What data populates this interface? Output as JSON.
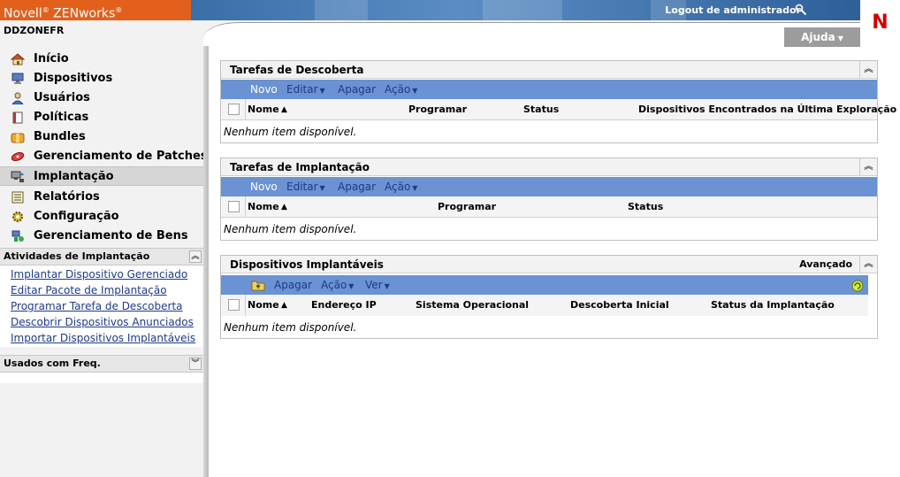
{
  "header": {
    "brand": "Novell® ZENworks®",
    "brand_name": "Novell",
    "brand_product": "ZENworks",
    "logout_label": "Logout de administrador",
    "logo_letter": "N",
    "zone_name": "DDZONEFR",
    "help_label": "Ajuda",
    "brand_color": "#e2601c"
  },
  "sidebar": {
    "nav": [
      {
        "label": "Início",
        "icon": "home-icon"
      },
      {
        "label": "Dispositivos",
        "icon": "monitor-icon"
      },
      {
        "label": "Usuários",
        "icon": "user-icon"
      },
      {
        "label": "Políticas",
        "icon": "policy-icon"
      },
      {
        "label": "Bundles",
        "icon": "bundle-icon"
      },
      {
        "label": "Gerenciamento de Patches",
        "icon": "patch-icon"
      },
      {
        "label": "Implantação",
        "icon": "deployment-icon",
        "active": true
      },
      {
        "label": "Relatórios",
        "icon": "report-icon"
      },
      {
        "label": "Configuração",
        "icon": "gear-icon"
      },
      {
        "label": "Gerenciamento de Bens",
        "icon": "asset-icon"
      }
    ],
    "activities_title": "Atividades de Implantação",
    "activities": [
      "Implantar Dispositivo Gerenciado",
      "Editar Pacote de Implantação",
      "Programar Tarefa de Descoberta",
      "Descobrir Dispositivos Anunciados",
      "Importar Dispositivos Implantáveis"
    ],
    "frequent_title": "Usados com Freq."
  },
  "panels": {
    "discovery": {
      "title": "Tarefas de Descoberta",
      "toolbar": {
        "new": "Novo",
        "edit": "Editar",
        "delete": "Apagar",
        "action": "Ação"
      },
      "columns": [
        "Nome",
        "Programar",
        "Status",
        "Dispositivos Encontrados na Última Exploração"
      ],
      "empty": "Nenhum item disponível."
    },
    "deployment": {
      "title": "Tarefas de Implantação",
      "toolbar": {
        "new": "Novo",
        "edit": "Editar",
        "delete": "Apagar",
        "action": "Ação"
      },
      "columns": [
        "Nome",
        "Programar",
        "Status"
      ],
      "empty": "Nenhum item disponível."
    },
    "deployable": {
      "title": "Dispositivos Implantáveis",
      "advanced": "Avançado",
      "toolbar": {
        "delete": "Apagar",
        "action": "Ação",
        "view": "Ver"
      },
      "columns": [
        "Nome",
        "Endereço IP",
        "Sistema Operacional",
        "Descoberta Inicial",
        "Status da Implantação"
      ],
      "empty": "Nenhum item disponível."
    }
  }
}
